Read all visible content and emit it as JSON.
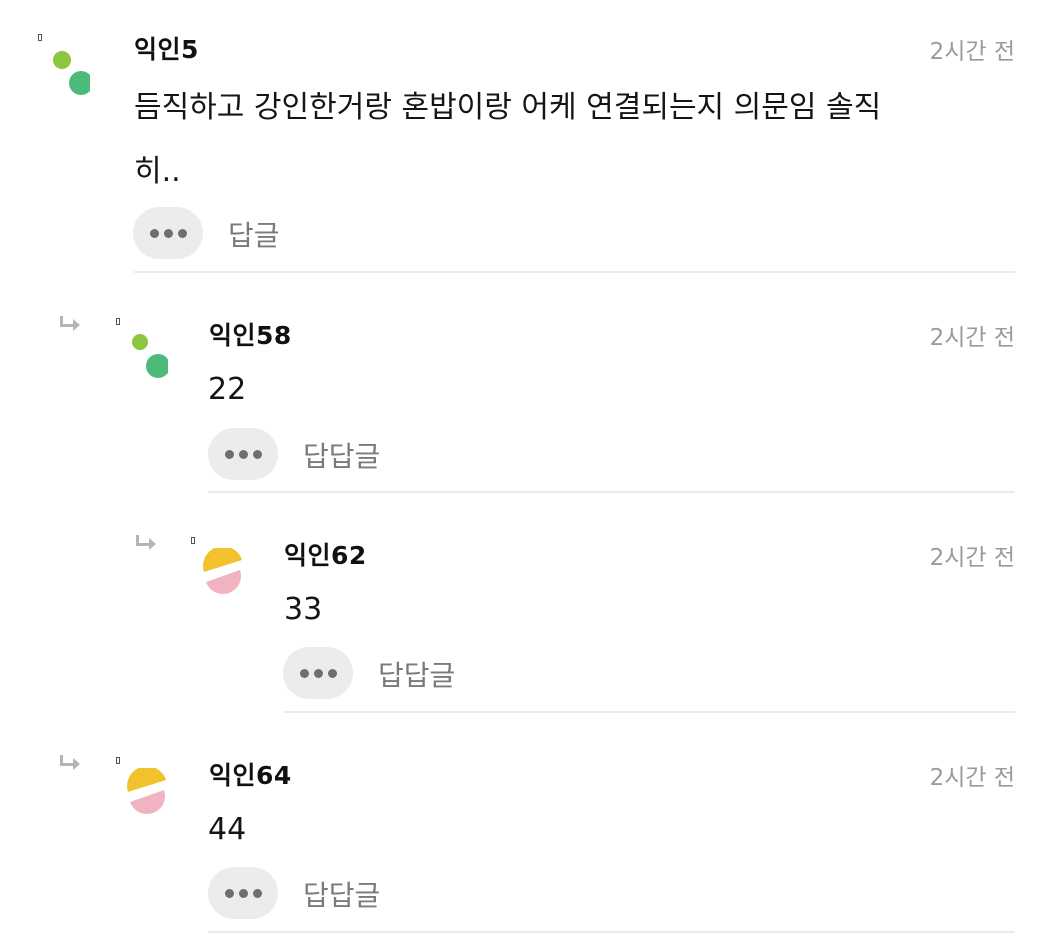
{
  "comments": [
    {
      "author_prefix": "익인",
      "author_num": "5",
      "time": "2시간 전",
      "text_line1": "듬직하고 강인한거랑 혼밥이랑 어케 연결되는지 의문임 솔직",
      "text_line2": "히..",
      "reply_label": "답글",
      "avatar": "green-dots"
    },
    {
      "author_prefix": "익인",
      "author_num": "58",
      "time": "2시간 전",
      "text": "22",
      "reply_label": "답답글",
      "avatar": "green-dots"
    },
    {
      "author_prefix": "익인",
      "author_num": "62",
      "time": "2시간 전",
      "text": "33",
      "reply_label": "답답글",
      "avatar": "yellow-pink-halves"
    },
    {
      "author_prefix": "익인",
      "author_num": "64",
      "time": "2시간 전",
      "text": "44",
      "reply_label": "답답글",
      "avatar": "yellow-pink-halves"
    }
  ],
  "icons": {
    "reply_arrow": "reply-arrow-icon",
    "more": "more-dots-icon"
  },
  "colors": {
    "green_light": "#8cc63f",
    "green_dark": "#4cbb7a",
    "yellow": "#f2c12e",
    "pink": "#f2b3c0",
    "time_gray": "#9a9a9a",
    "divider": "#ebebeb",
    "button_bg": "#ececec"
  }
}
